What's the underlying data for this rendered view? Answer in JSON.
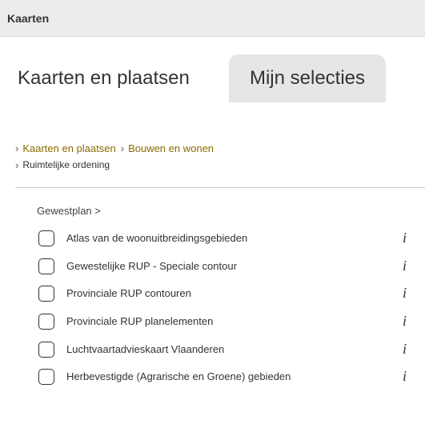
{
  "header": {
    "title": "Kaarten"
  },
  "tabs": [
    {
      "label": "Kaarten en plaatsen",
      "active": true
    },
    {
      "label": "Mijn selecties",
      "active": false
    }
  ],
  "breadcrumb": {
    "root": "Kaarten en plaatsen",
    "level2": "Bouwen en wonen",
    "current": "Ruimtelijke ordening"
  },
  "section": {
    "title": "Gewestplan >"
  },
  "layers": [
    {
      "label": "Atlas van de woonuitbreidingsgebieden",
      "info_icon": "i",
      "checked": false
    },
    {
      "label": "Gewestelijke RUP - Speciale contour",
      "info_icon": "i",
      "checked": false
    },
    {
      "label": "Provinciale RUP contouren",
      "info_icon": "i",
      "checked": false
    },
    {
      "label": "Provinciale RUP planelementen",
      "info_icon": "i",
      "checked": false
    },
    {
      "label": "Luchtvaartadvieskaart Vlaanderen",
      "info_icon": "i",
      "checked": false
    },
    {
      "label": "Herbevestigde (Agrarische en Groene) gebieden",
      "info_icon": "i",
      "checked": false
    }
  ],
  "colors": {
    "link": "#8b6c00",
    "header_bg": "#ececec",
    "inactive_tab": "#e6e6e6"
  }
}
